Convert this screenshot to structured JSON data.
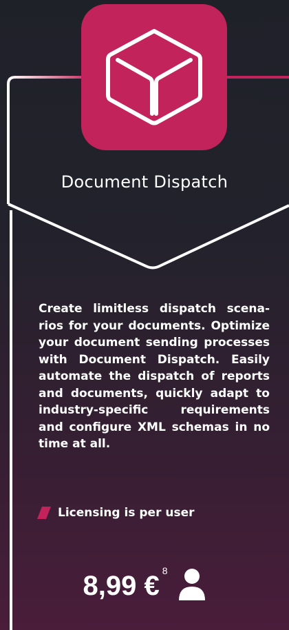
{
  "product": {
    "name": "Document Dispatch",
    "description": "Create limitless dispatch scena-rios for your documents. Optimize your document sending processes with Document Dispatch. Easily automate the dispatch of reports and documents, quickly adapt to industry-specific requirements and configure XML schemas in no time at all."
  },
  "licensing": {
    "text": "Licensing is per user",
    "icon": "slash-accent-icon"
  },
  "pricing": {
    "price": "8,99 €",
    "footnote": "8",
    "icon": "user-icon"
  },
  "colors": {
    "accent": "#c2235a",
    "outline": "#ffffff",
    "background_top": "#1f2129",
    "background_bottom": "#4a1d3b"
  }
}
